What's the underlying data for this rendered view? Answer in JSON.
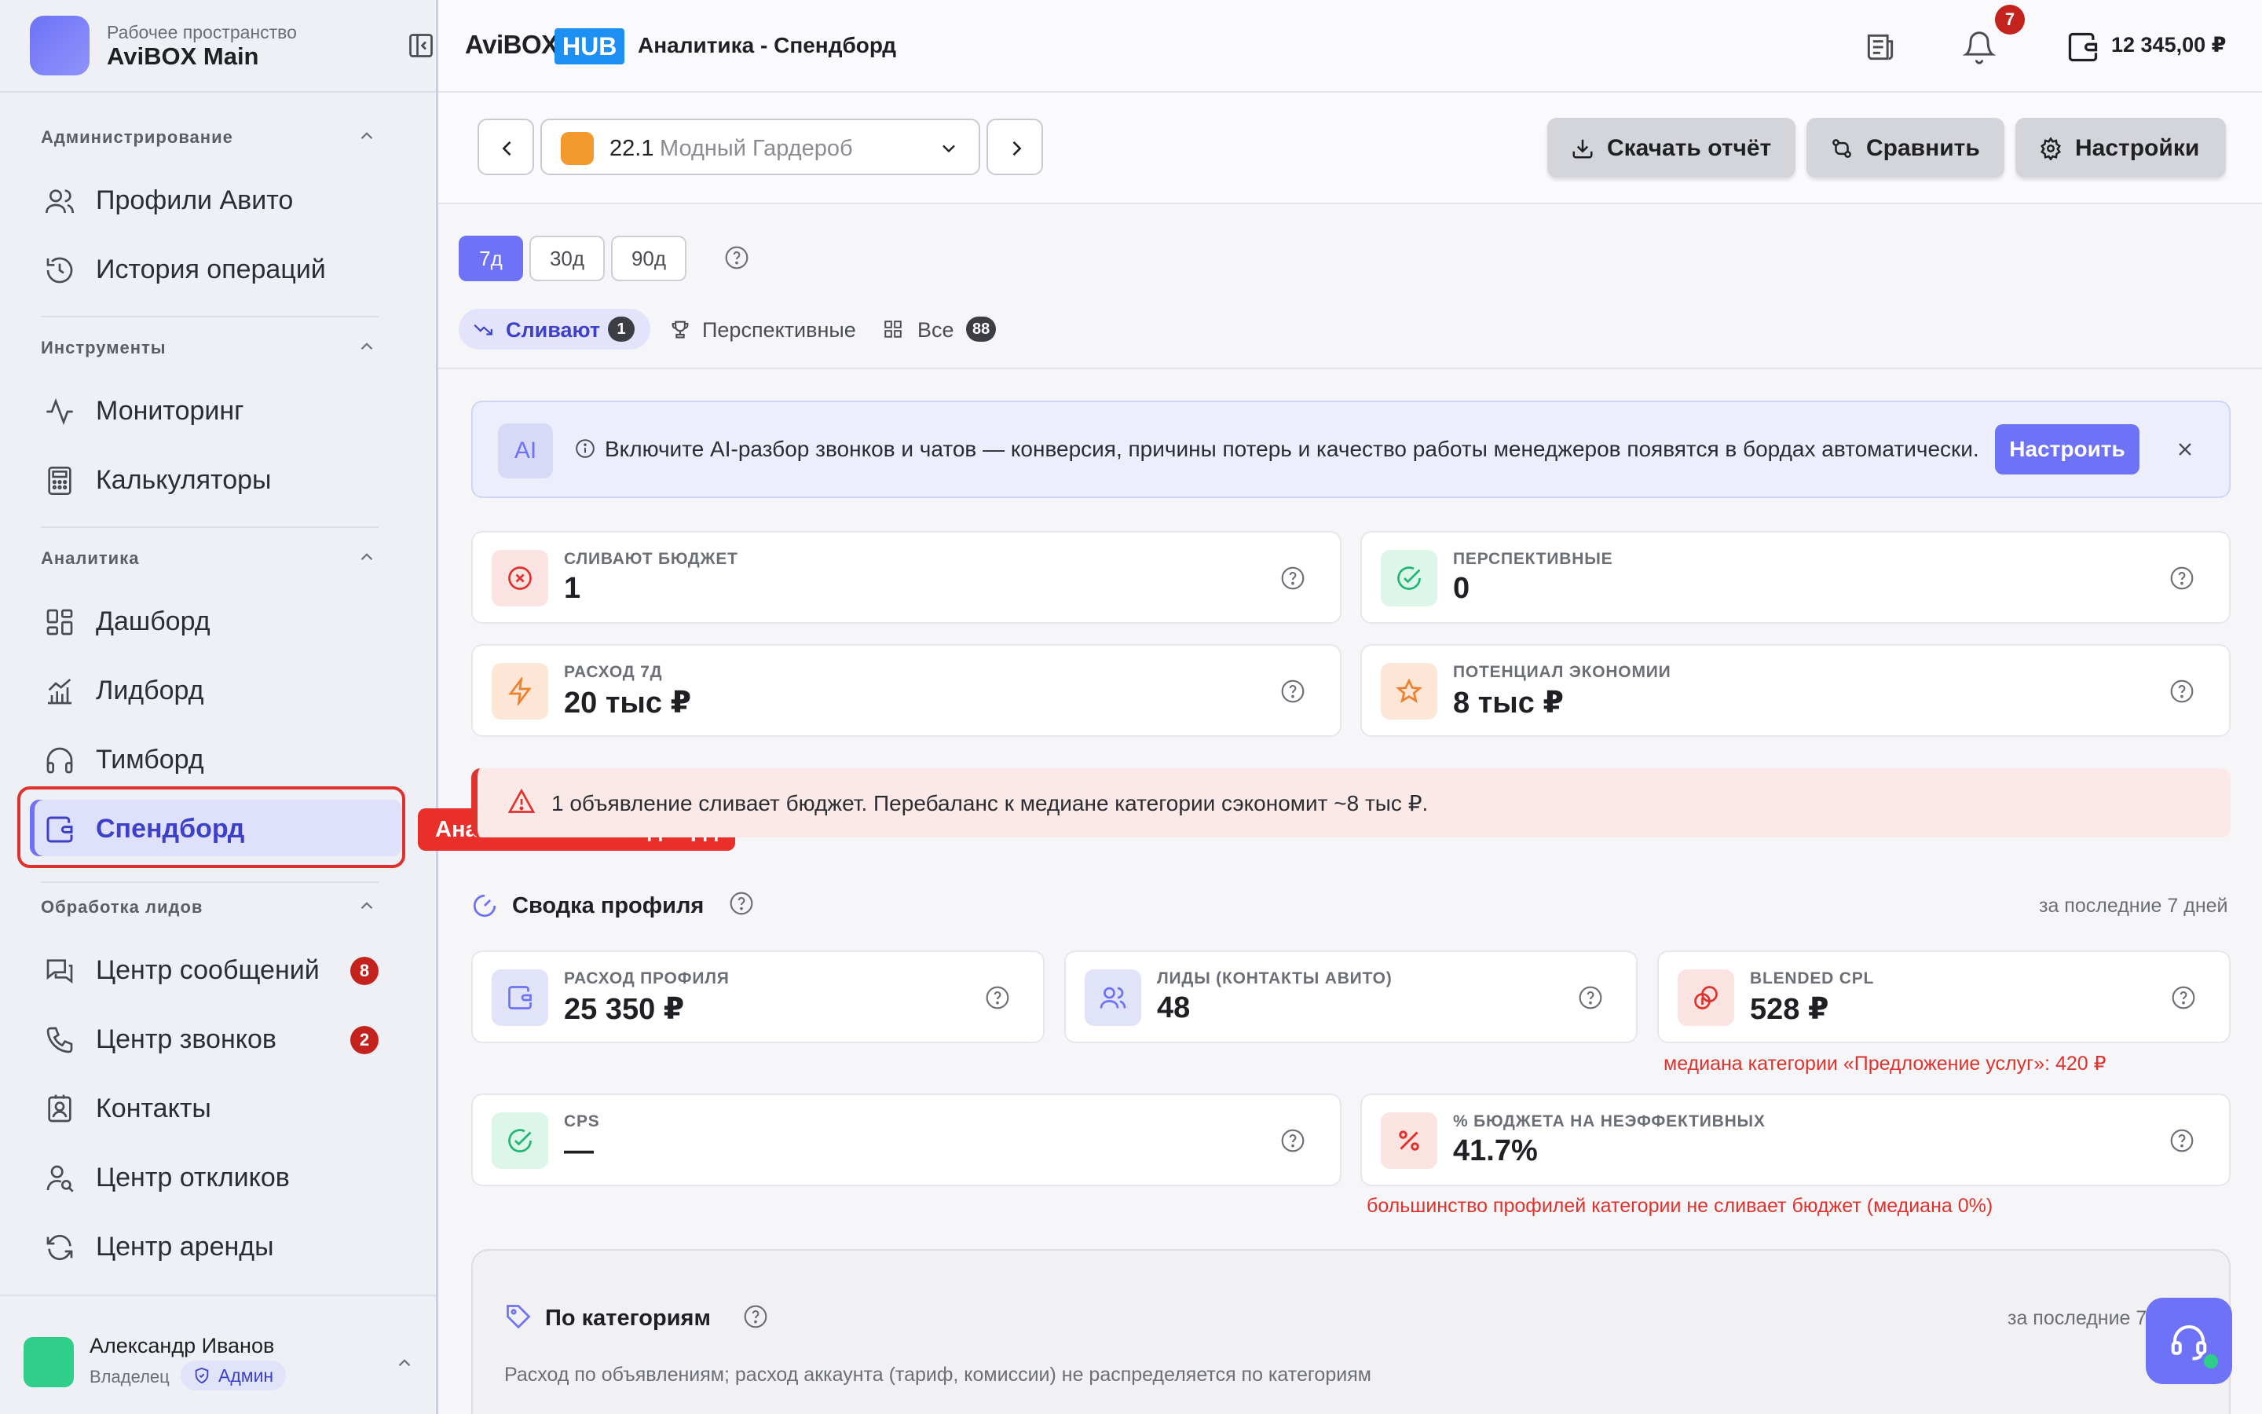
{
  "workspace": {
    "subtitle": "Рабочее пространство",
    "name": "AviBOX Main"
  },
  "sidebar": {
    "sections": [
      {
        "title": "Администрирование",
        "items": [
          {
            "label": "Профили Авито",
            "icon": "users-icon"
          },
          {
            "label": "История операций",
            "icon": "history-icon"
          }
        ]
      },
      {
        "title": "Инструменты",
        "items": [
          {
            "label": "Мониторинг",
            "icon": "activity-icon"
          },
          {
            "label": "Калькуляторы",
            "icon": "calculator-icon"
          }
        ]
      },
      {
        "title": "Аналитика",
        "items": [
          {
            "label": "Дашборд",
            "icon": "dashboard-icon"
          },
          {
            "label": "Лидборд",
            "icon": "chart-icon"
          },
          {
            "label": "Тимборд",
            "icon": "headphones-icon"
          },
          {
            "label": "Спендборд",
            "icon": "wallet-icon",
            "active": true
          }
        ]
      },
      {
        "title": "Обработка лидов",
        "items": [
          {
            "label": "Центр сообщений",
            "icon": "messages-icon",
            "badge": "8"
          },
          {
            "label": "Центр звонков",
            "icon": "phone-icon",
            "badge": "2"
          },
          {
            "label": "Контакты",
            "icon": "contacts-icon"
          },
          {
            "label": "Центр откликов",
            "icon": "user-search-icon"
          },
          {
            "label": "Центр аренды",
            "icon": "refresh-icon"
          }
        ]
      }
    ],
    "tooltip": "Аналитика → Спендборд"
  },
  "user": {
    "name": "Александр Иванов",
    "role": "Владелец",
    "badge": "Админ"
  },
  "header": {
    "brand": "AviBOX",
    "brand_hub": "HUB",
    "title": "Аналитика - Спендборд",
    "notifications": "7",
    "balance": "12 345,00 ₽"
  },
  "toolbar": {
    "profile_num": "22.1",
    "profile_name": "Модный Гардероб",
    "download": "Скачать отчёт",
    "compare": "Сравнить",
    "settings": "Настройки"
  },
  "periods": [
    "7д",
    "30д",
    "90д"
  ],
  "filters": {
    "leaking": {
      "label": "Сливают",
      "count": "1"
    },
    "promising": {
      "label": "Перспективные"
    },
    "all": {
      "label": "Все",
      "count": "88"
    }
  },
  "ai_banner": {
    "tag": "AI",
    "text": "Включите AI-разбор звонков и чатов — конверсия, причины потерь и качество работы менеджеров появятся в бордах автоматически.",
    "button": "Настроить"
  },
  "kpi": {
    "leak": {
      "label": "СЛИВАЮТ БЮДЖЕТ",
      "value": "1"
    },
    "prospective": {
      "label": "ПЕРСПЕКТИВНЫЕ",
      "value": "0"
    },
    "spend": {
      "label": "РАСХОД 7Д",
      "value": "20 тыс ₽"
    },
    "saving": {
      "label": "ПОТЕНЦИАЛ ЭКОНОМИИ",
      "value": "8 тыс ₽"
    }
  },
  "alert": "1 объявление сливает бюджет. Перебаланс к медиане категории сэкономит ~8 тыс ₽.",
  "summary": {
    "title": "Сводка профиля",
    "period": "за последние 7 дней",
    "spend": {
      "label": "РАСХОД ПРОФИЛЯ",
      "value": "25 350 ₽"
    },
    "leads": {
      "label": "ЛИДЫ (КОНТАКТЫ АВИТО)",
      "value": "48"
    },
    "cpl": {
      "label": "BLENDED CPL",
      "value": "528 ₽",
      "note": "медиана категории «Предложение услуг»: 420 ₽"
    },
    "cps": {
      "label": "CPS",
      "value": "—"
    },
    "waste": {
      "label": "% БЮДЖЕТА НА НЕЭФФЕКТИВНЫХ",
      "value": "41.7%",
      "note": "большинство профилей категории не сливает бюджет (медиана 0%)"
    }
  },
  "categories": {
    "title": "По категориям",
    "period": "за последние 7",
    "subtitle": "Расход по объявлениям; расход аккаунта (тариф, комиссии) не распределяется по категориям"
  },
  "colors": {
    "accent": "#6d72f6",
    "danger": "#e0322c",
    "success": "#2fce8a",
    "hub": "#1e8ff3"
  }
}
